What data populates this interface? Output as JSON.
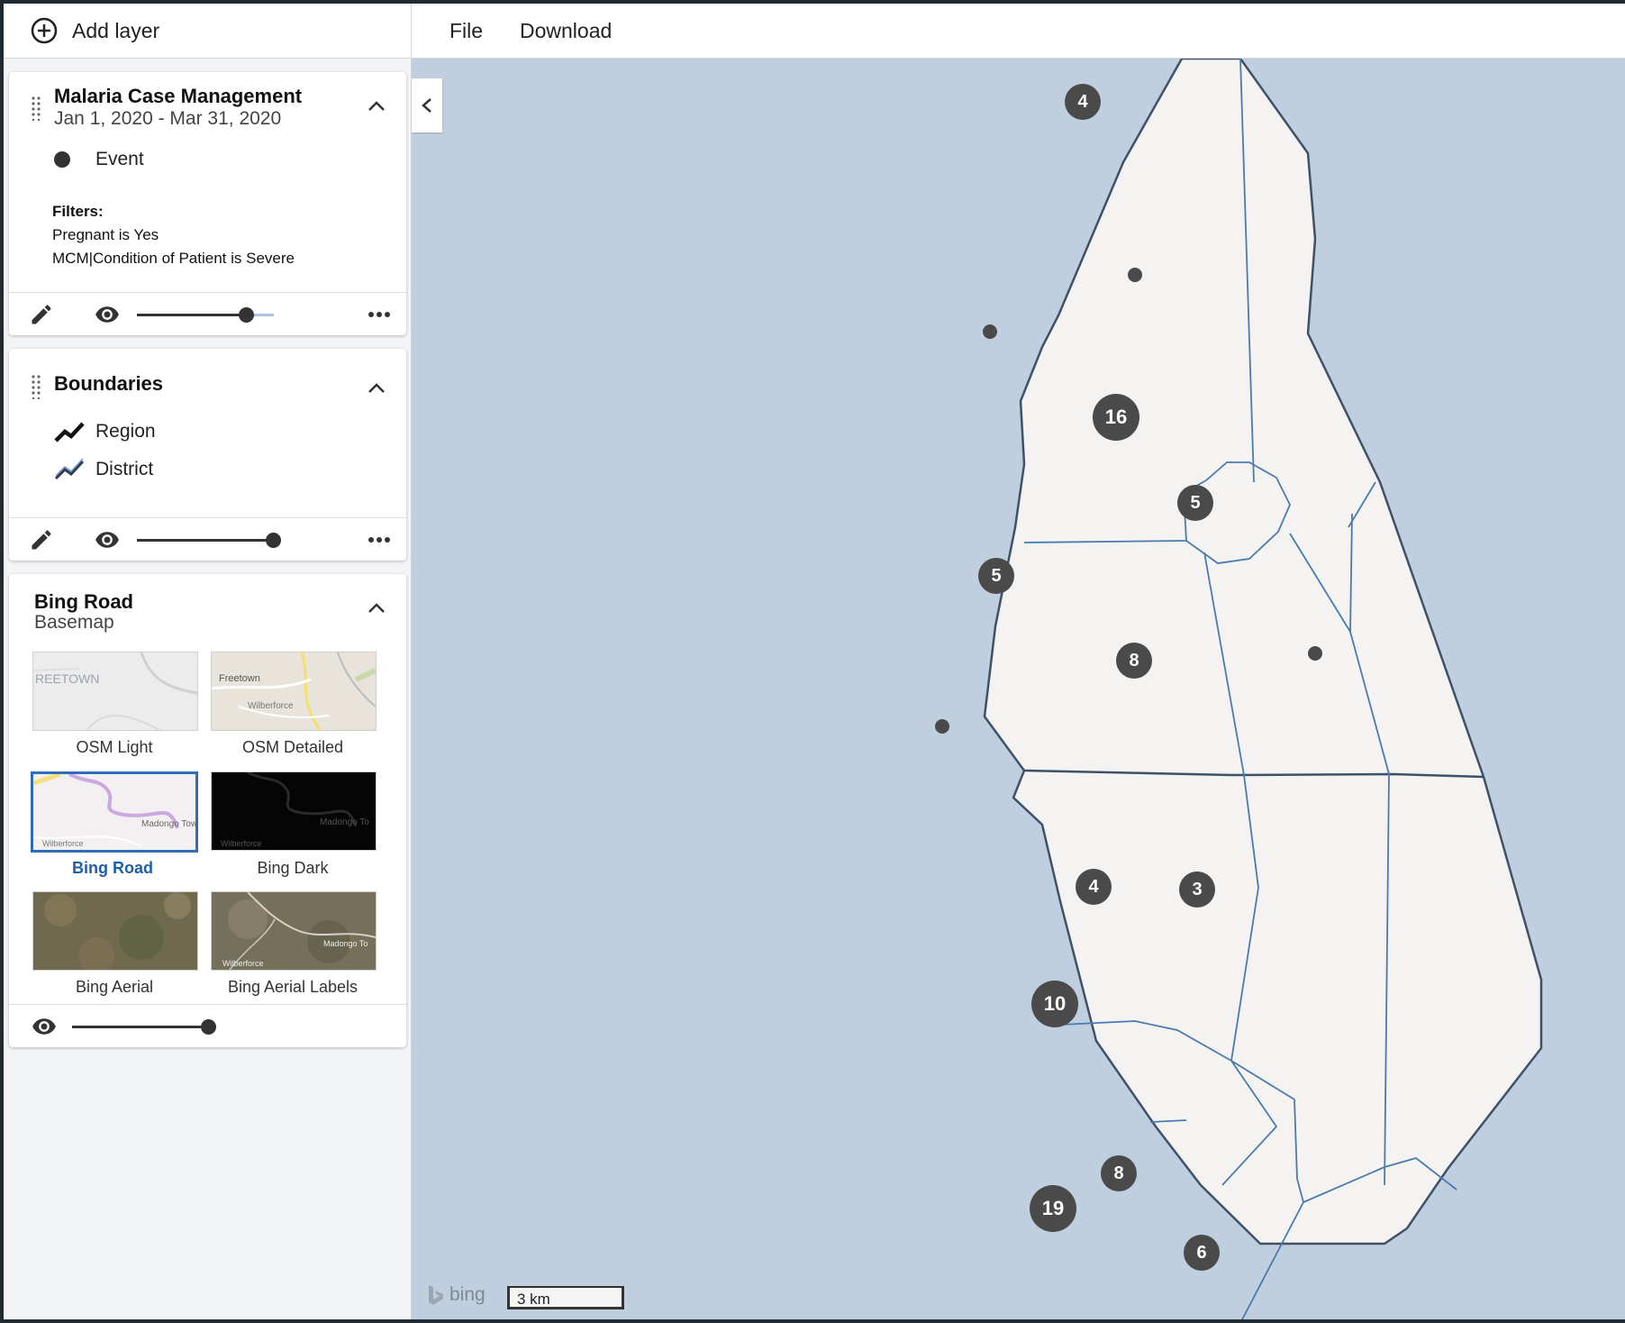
{
  "toolbar": {
    "add_layer": "Add layer",
    "menu": [
      "File",
      "Download"
    ]
  },
  "layers": {
    "events": {
      "title": "Malaria Case Management",
      "period": "Jan 1, 2020 - Mar 31, 2020",
      "legend_item": "Event",
      "filters_label": "Filters:",
      "filters": [
        "Pregnant is Yes",
        "MCM|Condition of Patient is Severe"
      ],
      "opacity": 0.8
    },
    "boundaries": {
      "title": "Boundaries",
      "legend": [
        "Region",
        "District"
      ],
      "opacity": 1.0
    },
    "basemap": {
      "title": "Bing Road",
      "subtitle": "Basemap",
      "options": [
        "OSM Light",
        "OSM Detailed",
        "Bing Road",
        "Bing Dark",
        "Bing Aerial",
        "Bing Aerial Labels"
      ],
      "selected": "Bing Road",
      "opacity": 1.0,
      "thumb_text": {
        "osm_light": "REETOWN",
        "osm_detailed_1": "Freetown",
        "osm_detailed_2": "Wilberforce",
        "bing_road_1": "Madongo Tow",
        "bing_road_2": "Wilberforce",
        "bing_dark_1": "Madongo To",
        "bing_dark_2": "Wilberforce",
        "aerial_labels_1": "Madongo To",
        "aerial_labels_2": "Wilberforce"
      }
    }
  },
  "map": {
    "clusters": [
      "4",
      "16",
      "5",
      "5",
      "8",
      "4",
      "3",
      "10",
      "19",
      "8",
      "6"
    ],
    "attribution": "bing",
    "scale_label": "3 km",
    "colors": {
      "water": "#c0cfe0",
      "land": "#f4f3f1",
      "region_border": "#3d5168",
      "district_border": "#4a7bb0",
      "cluster": "#4a4a4a"
    }
  }
}
